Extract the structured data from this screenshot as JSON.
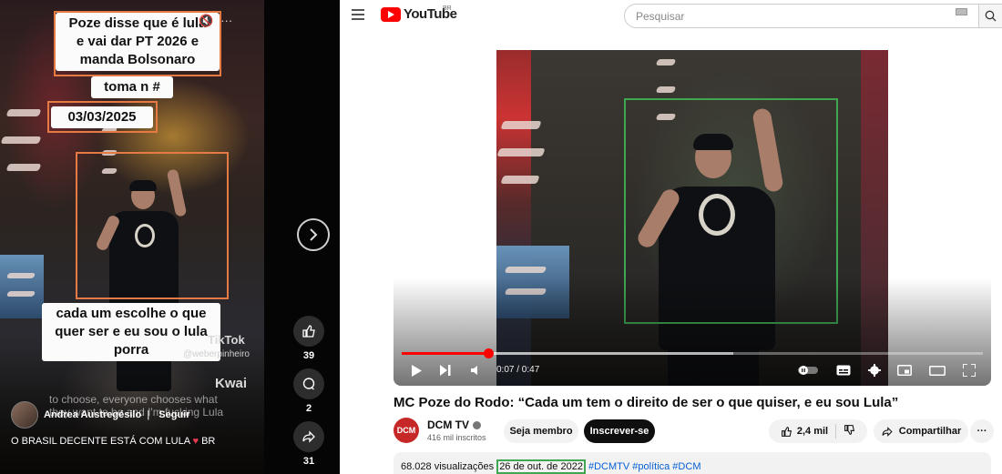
{
  "tiktok": {
    "caption_top": [
      "Poze disse que é lula",
      "e vai dar PT 2026 e",
      "manda Bolsonaro"
    ],
    "caption_toma": "toma n #",
    "caption_date": "03/03/2025",
    "caption_bottom": [
      "cada um escolhe o que",
      "quer ser e eu sou o lula",
      "porra"
    ],
    "top_icons": {
      "speaker": "🔇",
      "more": "···"
    },
    "watermark": "TikTok",
    "watermark_user": "@weberpinheiro",
    "kwai": "Kwai",
    "subtitle_en": "to choose, everyone chooses what they want to be and I'm fucking Lula",
    "author": "Andrea Austregésilo",
    "follow": "Seguir",
    "description": "O BRASIL DECENTE ESTÁ COM LULA",
    "description_flag": "BR",
    "likes": "39",
    "comments": "2",
    "shares": "31",
    "icons": [
      "chevron-right-icon",
      "like-icon",
      "comment-icon",
      "share-icon"
    ]
  },
  "youtube": {
    "logo_text": "YouTube",
    "region": "BR",
    "search_placeholder": "Pesquisar",
    "time": "0:07 / 0:47",
    "progress_fraction": 0.149,
    "buffer_fraction": 0.57,
    "title": "MC Poze do Rodo: “Cada um tem o direito de ser o que quiser, e eu sou Lula”",
    "channel": {
      "avatar": "DCM",
      "name": "DCM TV",
      "subs": "416 mil inscritos"
    },
    "member_label": "Seja membro",
    "subscribe_label": "Inscrever-se",
    "likes": "2,4 mil",
    "share_label": "Compartilhar",
    "more_label": "···",
    "views": "68.028 visualizações",
    "date": "26 de out. de 2022",
    "hashtags": "#DCMTV #política #DCM",
    "colors": {
      "brand_red": "#ff0000",
      "highlight_orange": "#e57a44",
      "highlight_green": "#3fa652"
    }
  }
}
